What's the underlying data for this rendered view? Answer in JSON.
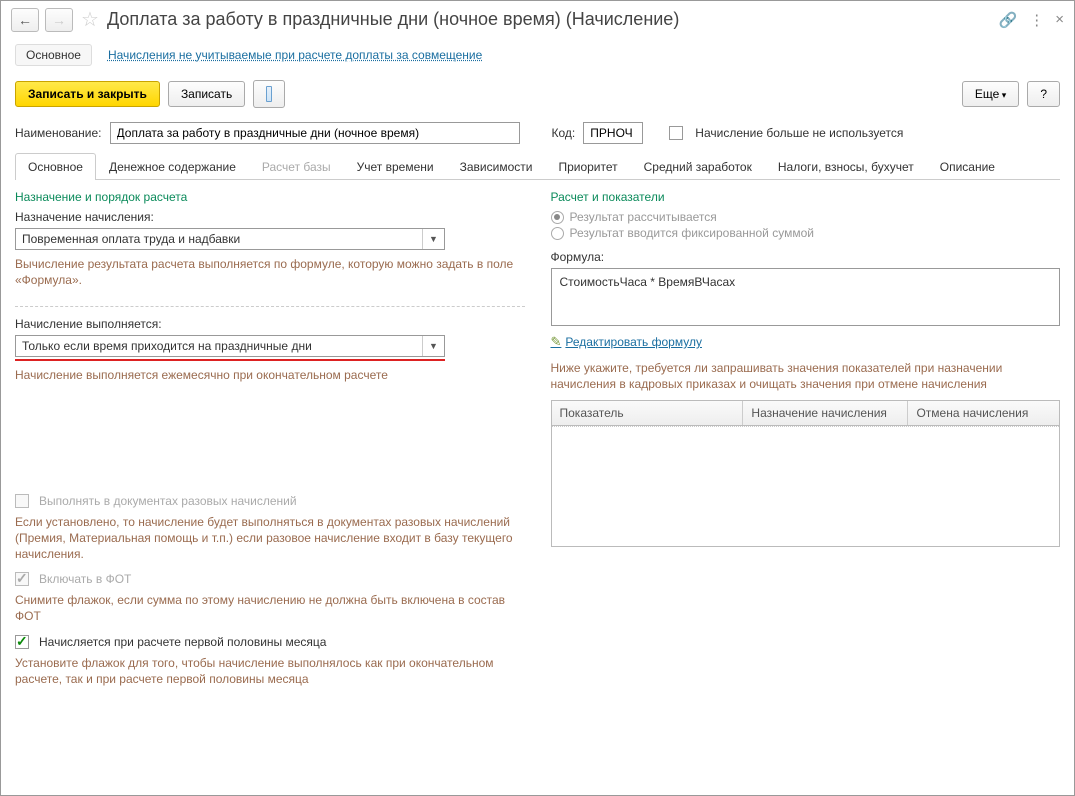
{
  "titlebar": {
    "title": "Доплата за работу в праздничные дни (ночное время) (Начисление)"
  },
  "topnav": {
    "main": "Основное",
    "link": "Начисления не учитываемые при расчете доплаты за совмещение"
  },
  "toolbar": {
    "save_close": "Записать и закрыть",
    "save": "Записать",
    "more": "Еще",
    "help": "?"
  },
  "form": {
    "name_label": "Наименование:",
    "name_value": "Доплата за работу в праздничные дни (ночное время)",
    "code_label": "Код:",
    "code_value": "ПРНОЧ",
    "not_used": "Начисление больше не используется"
  },
  "tabs": [
    "Основное",
    "Денежное содержание",
    "Расчет базы",
    "Учет времени",
    "Зависимости",
    "Приоритет",
    "Средний заработок",
    "Налоги, взносы, бухучет",
    "Описание"
  ],
  "left": {
    "section1": "Назначение и порядок расчета",
    "purpose_label": "Назначение начисления:",
    "purpose_value": "Повременная оплата труда и надбавки",
    "purpose_help": "Вычисление результата расчета выполняется по формуле, которую можно задать в поле «Формула».",
    "perform_label": "Начисление выполняется:",
    "perform_value": "Только если время приходится на праздничные дни",
    "perform_help": "Начисление выполняется ежемесячно при окончательном расчете",
    "chk_razov": "Выполнять в документах разовых начислений",
    "chk_razov_help": "Если установлено, то начисление будет выполняться в документах разовых начислений (Премия, Материальная помощь и т.п.) если разовое начисление входит в базу текущего начисления.",
    "chk_fot": "Включать в ФОТ",
    "chk_fot_help": "Снимите флажок, если сумма по этому начислению не должна быть включена в состав ФОТ",
    "chk_half": "Начисляется при расчете первой половины месяца",
    "chk_half_help": "Установите флажок для того, чтобы начисление выполнялось как при окончательном расчете, так и при расчете первой половины месяца"
  },
  "right": {
    "section": "Расчет и показатели",
    "radio1": "Результат рассчитывается",
    "radio2": "Результат вводится фиксированной суммой",
    "formula_label": "Формула:",
    "formula_value": "СтоимостьЧаса * ВремяВЧасах",
    "edit_link": "Редактировать формулу",
    "hint": "Ниже укажите, требуется ли запрашивать значения показателей при назначении начисления в кадровых приказах и очищать значения при отмене начисления",
    "grid_headers": [
      "Показатель",
      "Назначение начисления",
      "Отмена начисления"
    ]
  }
}
